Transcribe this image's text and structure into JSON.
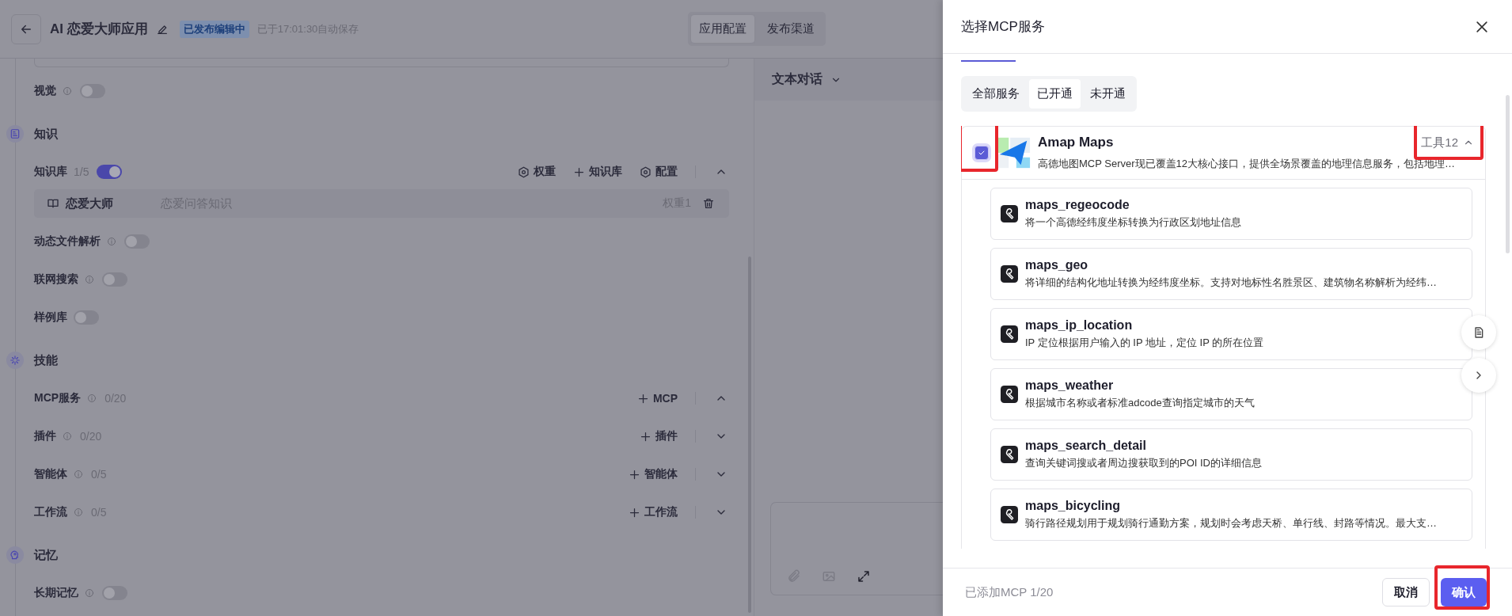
{
  "header": {
    "title": "AI 恋爱大师应用",
    "badge": "已发布编辑中",
    "autosave": "已于17:01:30自动保存",
    "tabs": [
      {
        "label": "应用配置",
        "selected": true
      },
      {
        "label": "发布渠道",
        "selected": false
      }
    ]
  },
  "config": [
    {
      "kind": "toggle",
      "label": "视觉",
      "info": true,
      "on": false
    },
    {
      "kind": "section",
      "label": "知识"
    },
    {
      "kind": "library",
      "label": "知识库",
      "count": "1/5",
      "on": true,
      "expanded": true,
      "actions": [
        {
          "kind": "weight",
          "label": "权重"
        },
        {
          "kind": "add",
          "label": "知识库"
        },
        {
          "kind": "settings",
          "label": "配置"
        }
      ],
      "items": [
        {
          "name": "恋爱大师",
          "description": "恋爱问答知识",
          "weight": "权重1"
        }
      ]
    },
    {
      "kind": "toggle",
      "label": "动态文件解析",
      "info": true,
      "on": false
    },
    {
      "kind": "toggle",
      "label": "联网搜索",
      "info": true,
      "on": false
    },
    {
      "kind": "toggle",
      "label": "样例库",
      "info": false,
      "on": false
    },
    {
      "kind": "section",
      "label": "技能"
    },
    {
      "kind": "skill",
      "label": "MCP服务",
      "info": true,
      "count": "0/20",
      "action": "MCP",
      "expanded": true
    },
    {
      "kind": "skill",
      "label": "插件",
      "info": true,
      "count": "0/20",
      "action": "插件",
      "expanded": false
    },
    {
      "kind": "skill",
      "label": "智能体",
      "info": true,
      "count": "0/5",
      "action": "智能体",
      "expanded": false
    },
    {
      "kind": "skill",
      "label": "工作流",
      "info": true,
      "count": "0/5",
      "action": "工作流",
      "expanded": false
    },
    {
      "kind": "section",
      "label": "记忆"
    },
    {
      "kind": "toggle",
      "label": "长期记忆",
      "info": true,
      "on": false
    }
  ],
  "chat": {
    "mode": "文本对话"
  },
  "drawer": {
    "title": "选择MCP服务",
    "tabs": [
      {
        "label": "全部服务",
        "selected": false
      },
      {
        "label": "已开通",
        "selected": true
      },
      {
        "label": "未开通",
        "selected": false
      }
    ],
    "services": [
      {
        "name": "Amap Maps",
        "description": "高德地图MCP Server现已覆盖12大核心接口，提供全场景覆盖的地理信息服务，包括地理…",
        "checked": true,
        "checkbox_highlighted": true,
        "tool_count": "工具12",
        "tools_highlighted": true,
        "expanded": true,
        "tools": [
          {
            "name": "maps_regeocode",
            "description": "将一个高德经纬度坐标转换为行政区划地址信息"
          },
          {
            "name": "maps_geo",
            "description": "将详细的结构化地址转换为经纬度坐标。支持对地标性名胜景区、建筑物名称解析为经纬…"
          },
          {
            "name": "maps_ip_location",
            "description": "IP 定位根据用户输入的 IP 地址，定位 IP 的所在位置"
          },
          {
            "name": "maps_weather",
            "description": "根据城市名称或者标准adcode查询指定城市的天气"
          },
          {
            "name": "maps_search_detail",
            "description": "查询关键词搜或者周边搜获取到的POI ID的详细信息"
          },
          {
            "name": "maps_bicycling",
            "description": "骑行路径规划用于规划骑行通勤方案，规划时会考虑天桥、单行线、封路等情况。最大支…"
          }
        ]
      }
    ],
    "footer": {
      "added": "已添加MCP 1/20",
      "buttons": [
        {
          "label": "取消",
          "kind": "secondary",
          "highlighted": false
        },
        {
          "label": "确认",
          "kind": "primary",
          "highlighted": true
        }
      ]
    }
  }
}
